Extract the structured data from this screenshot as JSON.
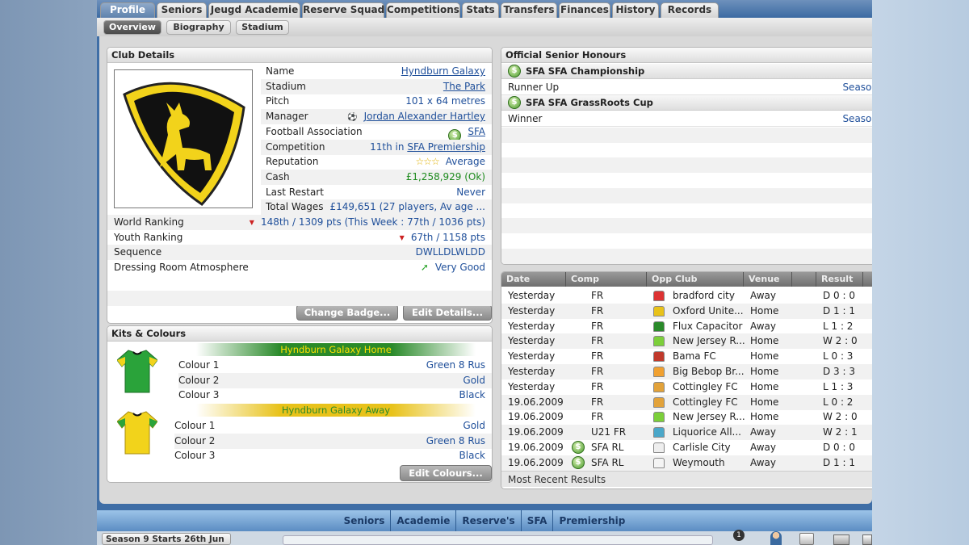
{
  "tabs": [
    "Profile",
    "Seniors",
    "Jeugd Academie",
    "Reserve Squad",
    "Competitions",
    "Stats",
    "Transfers",
    "Finances",
    "History",
    "Records"
  ],
  "subtabs": [
    "Overview",
    "Biography",
    "Stadium"
  ],
  "club_details": {
    "title": "Club Details",
    "rows": [
      {
        "label": "Name",
        "value": "Hyndburn Galaxy"
      },
      {
        "label": "Stadium",
        "value": "The Park"
      },
      {
        "label": "Pitch",
        "value": "101 x 64 metres"
      },
      {
        "label": "Manager",
        "value": "Jordan Alexander Hartley"
      },
      {
        "label": "Football Association",
        "value": "SFA"
      },
      {
        "label": "Competition",
        "value_prefix": "11th in",
        "value": "SFA Premiership"
      },
      {
        "label": "Reputation",
        "value": "Average"
      },
      {
        "label": "Cash",
        "value": "£1,258,929 (Ok)"
      },
      {
        "label": "Last Restart",
        "value": "Never"
      },
      {
        "label": "Total Wages",
        "value": "£149,651 (27 players, Av age ..."
      }
    ],
    "wide_rows": [
      {
        "label": "World Ranking",
        "value": "148th / 1309 pts (This Week : 77th / 1036 pts)"
      },
      {
        "label": "Youth Ranking",
        "value": "67th / 1158 pts"
      },
      {
        "label": "Sequence",
        "value": "DWLLDLWLDD"
      },
      {
        "label": "Dressing Room Atmosphere",
        "value": "Very Good"
      }
    ],
    "buttons": {
      "change_badge": "Change Badge...",
      "edit_details": "Edit Details..."
    },
    "colors": {
      "badge_yellow": "#f2d31b",
      "badge_black": "#111111",
      "trend_down": "#cc2222",
      "trend_up": "#2fa62f"
    }
  },
  "kits": {
    "title": "Kits & Colours",
    "home": {
      "name": "Hyndburn Galaxy Home",
      "colours": [
        {
          "label": "Colour 1",
          "value": "Green 8 Rus"
        },
        {
          "label": "Colour 2",
          "value": "Gold"
        },
        {
          "label": "Colour 3",
          "value": "Black"
        }
      ]
    },
    "away": {
      "name": "Hyndburn Galaxy Away",
      "colours": [
        {
          "label": "Colour 1",
          "value": "Gold"
        },
        {
          "label": "Colour 2",
          "value": "Green 8 Rus"
        },
        {
          "label": "Colour 3",
          "value": "Black"
        }
      ]
    },
    "edit_button": "Edit Colours..."
  },
  "honours": {
    "title": "Official Senior Honours",
    "items": [
      {
        "competition": "SFA SFA Championship",
        "result": "Runner Up",
        "season": "Season"
      },
      {
        "competition": "SFA SFA GrassRoots Cup",
        "result": "Winner",
        "season": "Season"
      }
    ]
  },
  "matches": {
    "headers": [
      "Date",
      "Comp",
      "Opp Club",
      "Venue",
      "Result"
    ],
    "rows": [
      {
        "date": "Yesterday",
        "comp": "FR",
        "opp": "bradford city",
        "venue": "Away",
        "result": "D 0 : 0",
        "kit": "#d33"
      },
      {
        "date": "Yesterday",
        "comp": "FR",
        "opp": "Oxford Unite...",
        "venue": "Home",
        "result": "D 1 : 1",
        "kit": "#e8c21a"
      },
      {
        "date": "Yesterday",
        "comp": "FR",
        "opp": "Flux Capacitor",
        "venue": "Away",
        "result": "L 1 : 2",
        "kit": "#2a8a2a"
      },
      {
        "date": "Yesterday",
        "comp": "FR",
        "opp": "New Jersey R...",
        "venue": "Home",
        "result": "W 2 : 0",
        "kit": "#7ccf3a"
      },
      {
        "date": "Yesterday",
        "comp": "FR",
        "opp": "Bama FC",
        "venue": "Home",
        "result": "L 0 : 3",
        "kit": "#c0392b"
      },
      {
        "date": "Yesterday",
        "comp": "FR",
        "opp": "Big Bebop Br...",
        "venue": "Home",
        "result": "D 3 : 3",
        "kit": "#f0a030"
      },
      {
        "date": "Yesterday",
        "comp": "FR",
        "opp": "Cottingley FC",
        "venue": "Home",
        "result": "L 1 : 3",
        "kit": "#e2a23a"
      },
      {
        "date": "19.06.2009",
        "comp": "FR",
        "opp": "Cottingley FC",
        "venue": "Home",
        "result": "L 0 : 2",
        "kit": "#e2a23a"
      },
      {
        "date": "19.06.2009",
        "comp": "FR",
        "opp": "New Jersey R...",
        "venue": "Home",
        "result": "W 2 : 0",
        "kit": "#7ccf3a"
      },
      {
        "date": "19.06.2009",
        "comp": "U21 FR",
        "opp": "Liquorice All...",
        "venue": "Away",
        "result": "W 2 : 1",
        "kit": "#4aa7c9"
      },
      {
        "date": "19.06.2009",
        "comp": "SFA RL",
        "opp": "Carlisle City",
        "venue": "Away",
        "result": "D 0 : 0",
        "kit": "#eeeeee",
        "comp_icon": true
      },
      {
        "date": "19.06.2009",
        "comp": "SFA RL",
        "opp": "Weymouth",
        "venue": "Away",
        "result": "D 1 : 1",
        "kit": "#f4f4f4",
        "comp_icon": true
      }
    ],
    "footer": "Most Recent Results"
  },
  "bottom_nav": [
    "Seniors",
    "Academie",
    "Reserve's",
    "SFA",
    "Premiership"
  ],
  "status": {
    "season_text": "Season 9 Starts 26th Jun",
    "notification_count": "1"
  }
}
